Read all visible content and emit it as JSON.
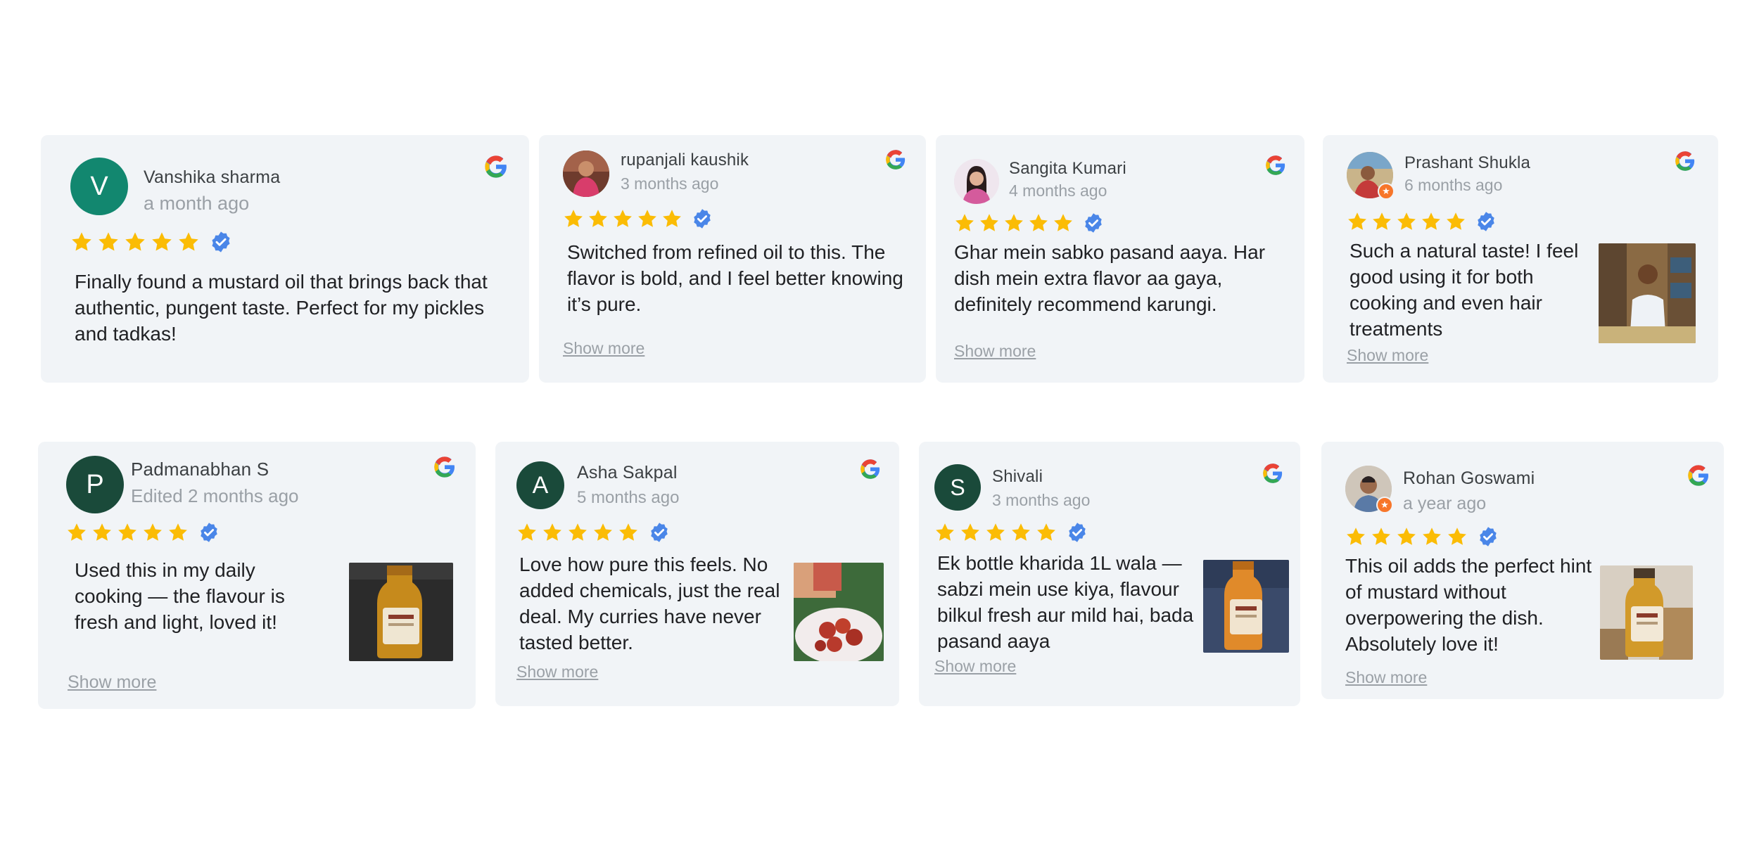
{
  "show_more_label": "Show more",
  "reviews": [
    {
      "name": "Vanshika sharma",
      "date": "a month ago",
      "rating": 5,
      "avatar_initial": "V",
      "avatar_color": "#12876f",
      "text": "Finally found a mustard oil that brings back that authentic, pungent taste. Perfect for my pickles and tadkas!"
    },
    {
      "name": "rupanjali kaushik",
      "date": "3 months ago",
      "rating": 5,
      "avatar_icon": "profile-photo",
      "text": "Switched from refined oil to this. The flavor is bold, and I feel better knowing it’s pure."
    },
    {
      "name": "Sangita Kumari",
      "date": "4 months ago",
      "rating": 5,
      "avatar_icon": "profile-photo",
      "text": "Ghar mein sabko pasand aaya. Har dish mein extra flavor aa gaya, definitely recommend karungi."
    },
    {
      "name": "Prashant Shukla",
      "date": "6 months ago",
      "rating": 5,
      "avatar_icon": "profile-photo",
      "text": "Such a natural taste! I feel good using it for both cooking and even hair treatments"
    },
    {
      "name": "Padmanabhan S",
      "date": "Edited 2 months ago",
      "rating": 5,
      "avatar_initial": "P",
      "avatar_color": "#1a4a3a",
      "text": "Used this in my daily cooking — the flavour is fresh and light, loved it!"
    },
    {
      "name": "Asha Sakpal",
      "date": "5 months ago",
      "rating": 5,
      "avatar_initial": "A",
      "avatar_color": "#1a4a3a",
      "text": "Love how pure this feels. No added chemicals, just the real deal. My curries have never tasted better."
    },
    {
      "name": "Shivali",
      "date": "3 months ago",
      "rating": 5,
      "avatar_initial": "S",
      "avatar_color": "#1a4a3a",
      "text": "Ek bottle kharida 1L wala — sabzi mein use kiya, flavour bilkul fresh aur mild hai, bada pasand aaya"
    },
    {
      "name": "Rohan Goswami",
      "date": "a year ago",
      "rating": 5,
      "avatar_icon": "profile-photo",
      "text": "This oil adds the perfect hint of mustard without overpowering the dish. Absolutely love it!"
    }
  ],
  "colors": {
    "star": "#fbbc05",
    "verified": "#4a86e8",
    "card_bg": "#f1f4f7"
  }
}
